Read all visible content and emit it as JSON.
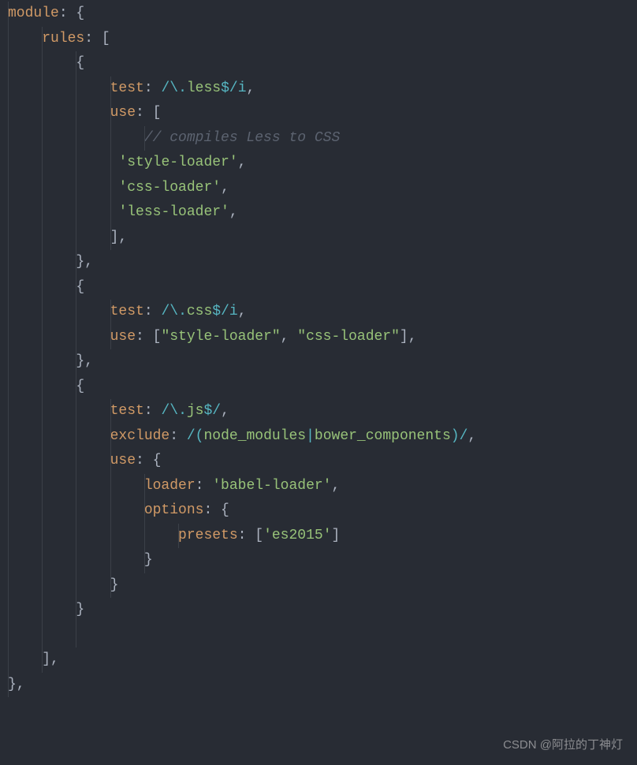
{
  "code": {
    "lines": [
      {
        "indent": 0,
        "segments": [
          {
            "t": "module",
            "c": "key"
          },
          {
            "t": ": {",
            "c": "punct"
          }
        ]
      },
      {
        "indent": 1,
        "segments": [
          {
            "t": "rules",
            "c": "key"
          },
          {
            "t": ": [",
            "c": "punct"
          }
        ]
      },
      {
        "indent": 2,
        "segments": [
          {
            "t": "{",
            "c": "punct"
          }
        ]
      },
      {
        "indent": 3,
        "segments": [
          {
            "t": "test",
            "c": "key"
          },
          {
            "t": ": ",
            "c": "punct"
          },
          {
            "t": "/",
            "c": "regex"
          },
          {
            "t": "\\.",
            "c": "regex-escape"
          },
          {
            "t": "less",
            "c": "regex-body"
          },
          {
            "t": "$",
            "c": "regex-escape"
          },
          {
            "t": "/i",
            "c": "regex"
          },
          {
            "t": ",",
            "c": "punct"
          }
        ]
      },
      {
        "indent": 3,
        "segments": [
          {
            "t": "use",
            "c": "key"
          },
          {
            "t": ": [",
            "c": "punct"
          }
        ]
      },
      {
        "indent": 4,
        "segments": [
          {
            "t": "// compiles Less to CSS",
            "c": "comment"
          }
        ]
      },
      {
        "indent": 3,
        "extra": " ",
        "segments": [
          {
            "t": "'style-loader'",
            "c": "string"
          },
          {
            "t": ",",
            "c": "punct"
          }
        ]
      },
      {
        "indent": 3,
        "extra": " ",
        "segments": [
          {
            "t": "'css-loader'",
            "c": "string"
          },
          {
            "t": ",",
            "c": "punct"
          }
        ]
      },
      {
        "indent": 3,
        "extra": " ",
        "segments": [
          {
            "t": "'less-loader'",
            "c": "string"
          },
          {
            "t": ",",
            "c": "punct"
          }
        ]
      },
      {
        "indent": 3,
        "segments": [
          {
            "t": "],",
            "c": "punct"
          }
        ]
      },
      {
        "indent": 2,
        "segments": [
          {
            "t": "},",
            "c": "punct"
          }
        ]
      },
      {
        "indent": 2,
        "segments": [
          {
            "t": "{",
            "c": "punct"
          }
        ]
      },
      {
        "indent": 3,
        "segments": [
          {
            "t": "test",
            "c": "key"
          },
          {
            "t": ": ",
            "c": "punct"
          },
          {
            "t": "/",
            "c": "regex"
          },
          {
            "t": "\\.",
            "c": "regex-escape"
          },
          {
            "t": "css",
            "c": "regex-body"
          },
          {
            "t": "$",
            "c": "regex-escape"
          },
          {
            "t": "/i",
            "c": "regex"
          },
          {
            "t": ",",
            "c": "punct"
          }
        ]
      },
      {
        "indent": 3,
        "segments": [
          {
            "t": "use",
            "c": "key"
          },
          {
            "t": ": [",
            "c": "punct"
          },
          {
            "t": "\"style-loader\"",
            "c": "string"
          },
          {
            "t": ", ",
            "c": "punct"
          },
          {
            "t": "\"css-loader\"",
            "c": "string"
          },
          {
            "t": "],",
            "c": "punct"
          }
        ]
      },
      {
        "indent": 2,
        "segments": [
          {
            "t": "},",
            "c": "punct"
          }
        ]
      },
      {
        "indent": 2,
        "segments": [
          {
            "t": "{",
            "c": "punct"
          }
        ]
      },
      {
        "indent": 3,
        "segments": [
          {
            "t": "test",
            "c": "key"
          },
          {
            "t": ": ",
            "c": "punct"
          },
          {
            "t": "/",
            "c": "regex"
          },
          {
            "t": "\\.",
            "c": "regex-escape"
          },
          {
            "t": "js",
            "c": "regex-body"
          },
          {
            "t": "$",
            "c": "regex-escape"
          },
          {
            "t": "/",
            "c": "regex"
          },
          {
            "t": ",",
            "c": "punct"
          }
        ]
      },
      {
        "indent": 3,
        "segments": [
          {
            "t": "exclude",
            "c": "key"
          },
          {
            "t": ": ",
            "c": "punct"
          },
          {
            "t": "/",
            "c": "regex"
          },
          {
            "t": "(",
            "c": "regex-escape"
          },
          {
            "t": "node_modules",
            "c": "regex-body"
          },
          {
            "t": "|",
            "c": "regex-escape"
          },
          {
            "t": "bower_components",
            "c": "regex-body"
          },
          {
            "t": ")",
            "c": "regex-escape"
          },
          {
            "t": "/",
            "c": "regex"
          },
          {
            "t": ",",
            "c": "punct"
          }
        ]
      },
      {
        "indent": 3,
        "segments": [
          {
            "t": "use",
            "c": "key"
          },
          {
            "t": ": {",
            "c": "punct"
          }
        ]
      },
      {
        "indent": 4,
        "segments": [
          {
            "t": "loader",
            "c": "key"
          },
          {
            "t": ": ",
            "c": "punct"
          },
          {
            "t": "'babel-loader'",
            "c": "string"
          },
          {
            "t": ",",
            "c": "punct"
          }
        ]
      },
      {
        "indent": 4,
        "segments": [
          {
            "t": "options",
            "c": "key"
          },
          {
            "t": ": {",
            "c": "punct"
          }
        ]
      },
      {
        "indent": 5,
        "segments": [
          {
            "t": "presets",
            "c": "key"
          },
          {
            "t": ": [",
            "c": "punct"
          },
          {
            "t": "'es2015'",
            "c": "string"
          },
          {
            "t": "]",
            "c": "punct"
          }
        ]
      },
      {
        "indent": 4,
        "segments": [
          {
            "t": "}",
            "c": "punct"
          }
        ]
      },
      {
        "indent": 3,
        "segments": [
          {
            "t": "}",
            "c": "punct"
          }
        ]
      },
      {
        "indent": 2,
        "segments": [
          {
            "t": "}",
            "c": "punct"
          }
        ]
      },
      {
        "indent": 2,
        "segments": [
          {
            "t": "",
            "c": "punct"
          }
        ]
      },
      {
        "indent": 1,
        "segments": [
          {
            "t": "],",
            "c": "punct"
          }
        ]
      },
      {
        "indent": 0,
        "segments": [
          {
            "t": "},",
            "c": "punct"
          }
        ]
      }
    ]
  },
  "watermark": "CSDN @阿拉的丁神灯",
  "indentSize": "    "
}
